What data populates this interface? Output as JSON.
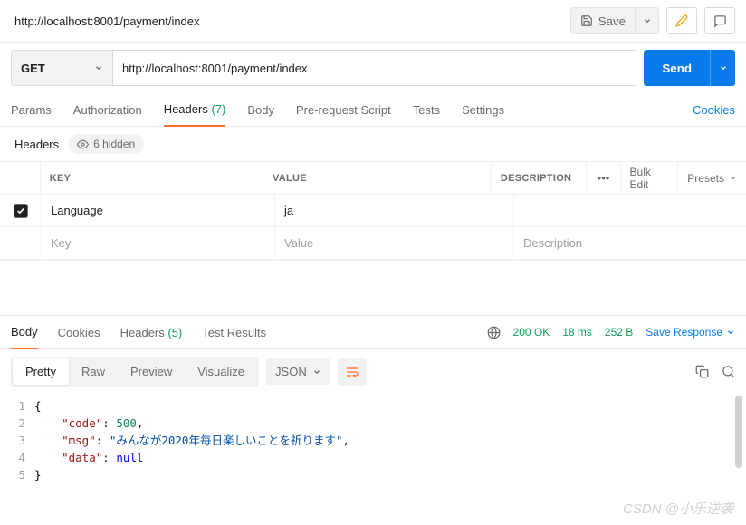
{
  "breadcrumb": "http://localhost:8001/payment/index",
  "top": {
    "save_label": "Save"
  },
  "request": {
    "method": "GET",
    "url": "http://localhost:8001/payment/index",
    "send_label": "Send"
  },
  "tabs": {
    "params": "Params",
    "authorization": "Authorization",
    "headers_label": "Headers",
    "headers_count": "(7)",
    "body": "Body",
    "prerequest": "Pre-request Script",
    "tests": "Tests",
    "settings": "Settings",
    "cookies": "Cookies"
  },
  "headers_section": {
    "title": "Headers",
    "hidden_label": "6 hidden",
    "columns": {
      "key": "KEY",
      "value": "VALUE",
      "description": "DESCRIPTION",
      "bulk": "Bulk Edit",
      "presets": "Presets"
    },
    "rows": [
      {
        "checked": true,
        "key": "Language",
        "value": "ja",
        "description": ""
      }
    ],
    "placeholder": {
      "key": "Key",
      "value": "Value",
      "description": "Description"
    }
  },
  "response": {
    "tabs": {
      "body": "Body",
      "cookies": "Cookies",
      "headers_label": "Headers",
      "headers_count": "(5)",
      "tests": "Test Results"
    },
    "status_code": "200 OK",
    "time": "18 ms",
    "size": "252 B",
    "save_response": "Save Response",
    "view_tabs": {
      "pretty": "Pretty",
      "raw": "Raw",
      "preview": "Preview",
      "visualize": "Visualize"
    },
    "format": "JSON",
    "json": {
      "code_key": "\"code\"",
      "code_val": "500",
      "msg_key": "\"msg\"",
      "msg_val": "\"みんなが2020年毎日楽しいことを祈ります\"",
      "data_key": "\"data\"",
      "data_val": "null"
    }
  },
  "watermark": "CSDN @小乐逆袭"
}
